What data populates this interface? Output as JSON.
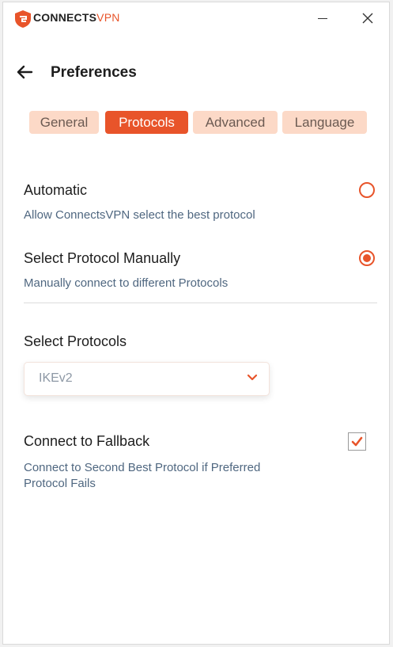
{
  "app": {
    "brand_main": "CONNECTS",
    "brand_accent": "VPN",
    "accent_color": "#e8542a"
  },
  "header": {
    "title": "Preferences"
  },
  "tabs": [
    {
      "label": "General",
      "active": false
    },
    {
      "label": "Protocols",
      "active": true
    },
    {
      "label": "Advanced",
      "active": false
    },
    {
      "label": "Language",
      "active": false
    }
  ],
  "options": {
    "automatic": {
      "title": "Automatic",
      "description": "Allow ConnectsVPN select the best protocol",
      "selected": false
    },
    "manual": {
      "title": "Select Protocol Manually",
      "description": "Manually connect to different Protocols",
      "selected": true
    }
  },
  "protocol_select": {
    "label": "Select Protocols",
    "value": "IKEv2"
  },
  "fallback": {
    "title": "Connect to Fallback",
    "description_line1": "Connect to Second Best Protocol if Preferred",
    "description_line2": "Protocol Fails",
    "checked": true
  }
}
